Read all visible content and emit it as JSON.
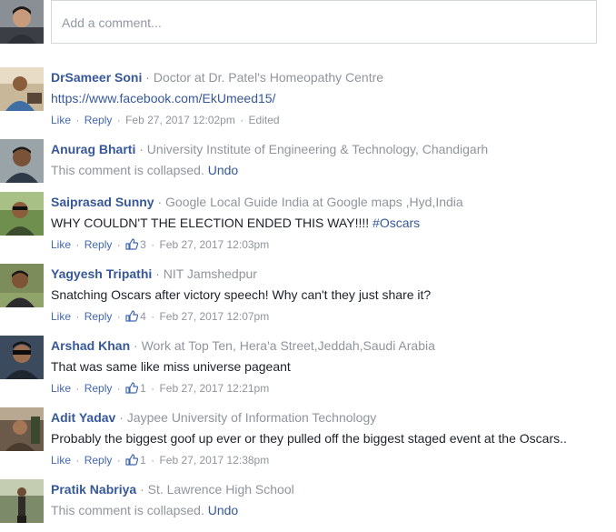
{
  "composer": {
    "placeholder": "Add a comment..."
  },
  "colors": {
    "link": "#365899",
    "action": "#4267b2",
    "meta": "#90949c",
    "text": "#1d2129",
    "border": "#d3d6db"
  },
  "comments": [
    {
      "author": "DrSameer Soni",
      "subtitle": "Doctor at Dr. Patel's Homeopathy Centre",
      "text": "https://www.facebook.com/EkUmeed15/",
      "like": "Like",
      "reply": "Reply",
      "time": "Feb 27, 2017 12:02pm",
      "edited": "Edited"
    },
    {
      "author": "Anurag Bharti",
      "subtitle": "University Institute of Engineering & Technology, Chandigarh",
      "collapsed_text": "This comment is collapsed.",
      "undo": "Undo"
    },
    {
      "author": "Saiprasad Sunny",
      "subtitle": "Google Local Guide India at Google maps ,Hyd,India",
      "text": "WHY COULDN'T THE ELECTION ENDED THIS WAY!!!! ",
      "hashtag": "#Oscars",
      "like": "Like",
      "reply": "Reply",
      "likes": "3",
      "time": "Feb 27, 2017 12:03pm"
    },
    {
      "author": "Yagyesh Tripathi",
      "subtitle": "NIT Jamshedpur",
      "text": "Snatching Oscars after victory speech! Why can't they just share it?",
      "like": "Like",
      "reply": "Reply",
      "likes": "4",
      "time": "Feb 27, 2017 12:07pm"
    },
    {
      "author": "Arshad Khan",
      "subtitle": "Work at Top Ten, Hera'a Street,Jeddah,Saudi Arabia",
      "text": "That was same like miss universe pageant",
      "like": "Like",
      "reply": "Reply",
      "likes": "1",
      "time": "Feb 27, 2017 12:21pm"
    },
    {
      "author": "Adit Yadav",
      "subtitle": "Jaypee University of Information Technology",
      "text": "Probably the biggest goof up ever or they pulled off the biggest staged event at the Oscars..",
      "like": "Like",
      "reply": "Reply",
      "likes": "1",
      "time": "Feb 27, 2017 12:38pm"
    },
    {
      "author": "Pratik Nabriya",
      "subtitle": "St. Lawrence High School",
      "collapsed_text": "This comment is collapsed.",
      "undo": "Undo"
    }
  ]
}
